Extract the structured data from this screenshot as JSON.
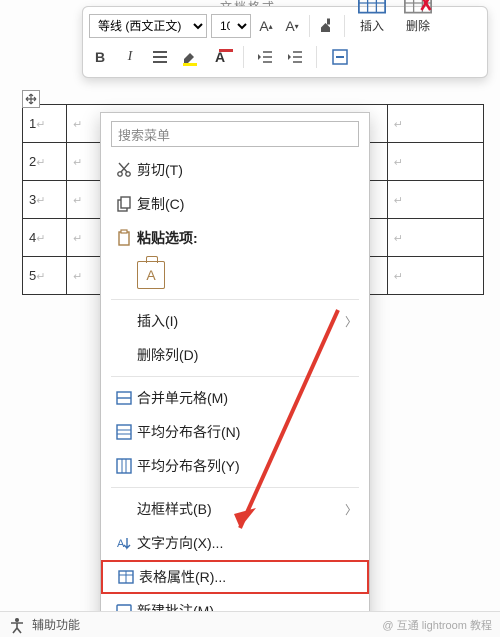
{
  "title_tab": "文档格式",
  "ribbon": {
    "font_name": "等线 (西文正文)",
    "font_size": "10",
    "insert_label": "插入",
    "delete_label": "删除"
  },
  "table": {
    "rows": [
      {
        "num": "1"
      },
      {
        "num": "2"
      },
      {
        "num": "3"
      },
      {
        "num": "4"
      },
      {
        "num": "5"
      }
    ]
  },
  "ctx": {
    "search_placeholder": "搜索菜单",
    "cut": "剪切(T)",
    "copy": "复制(C)",
    "paste_opts": "粘贴选项:",
    "paste_a": "A",
    "insert": "插入(I)",
    "del_col": "删除列(D)",
    "merge": "合并单元格(M)",
    "dist_rows": "平均分布各行(N)",
    "dist_cols": "平均分布各列(Y)",
    "border_style": "边框样式(B)",
    "text_dir": "文字方向(X)...",
    "table_props": "表格属性(R)...",
    "new_comment": "新建批注(M)"
  },
  "status": {
    "a11y": "辅助功能",
    "watermark": "@ 互通 lightroom 教程"
  }
}
